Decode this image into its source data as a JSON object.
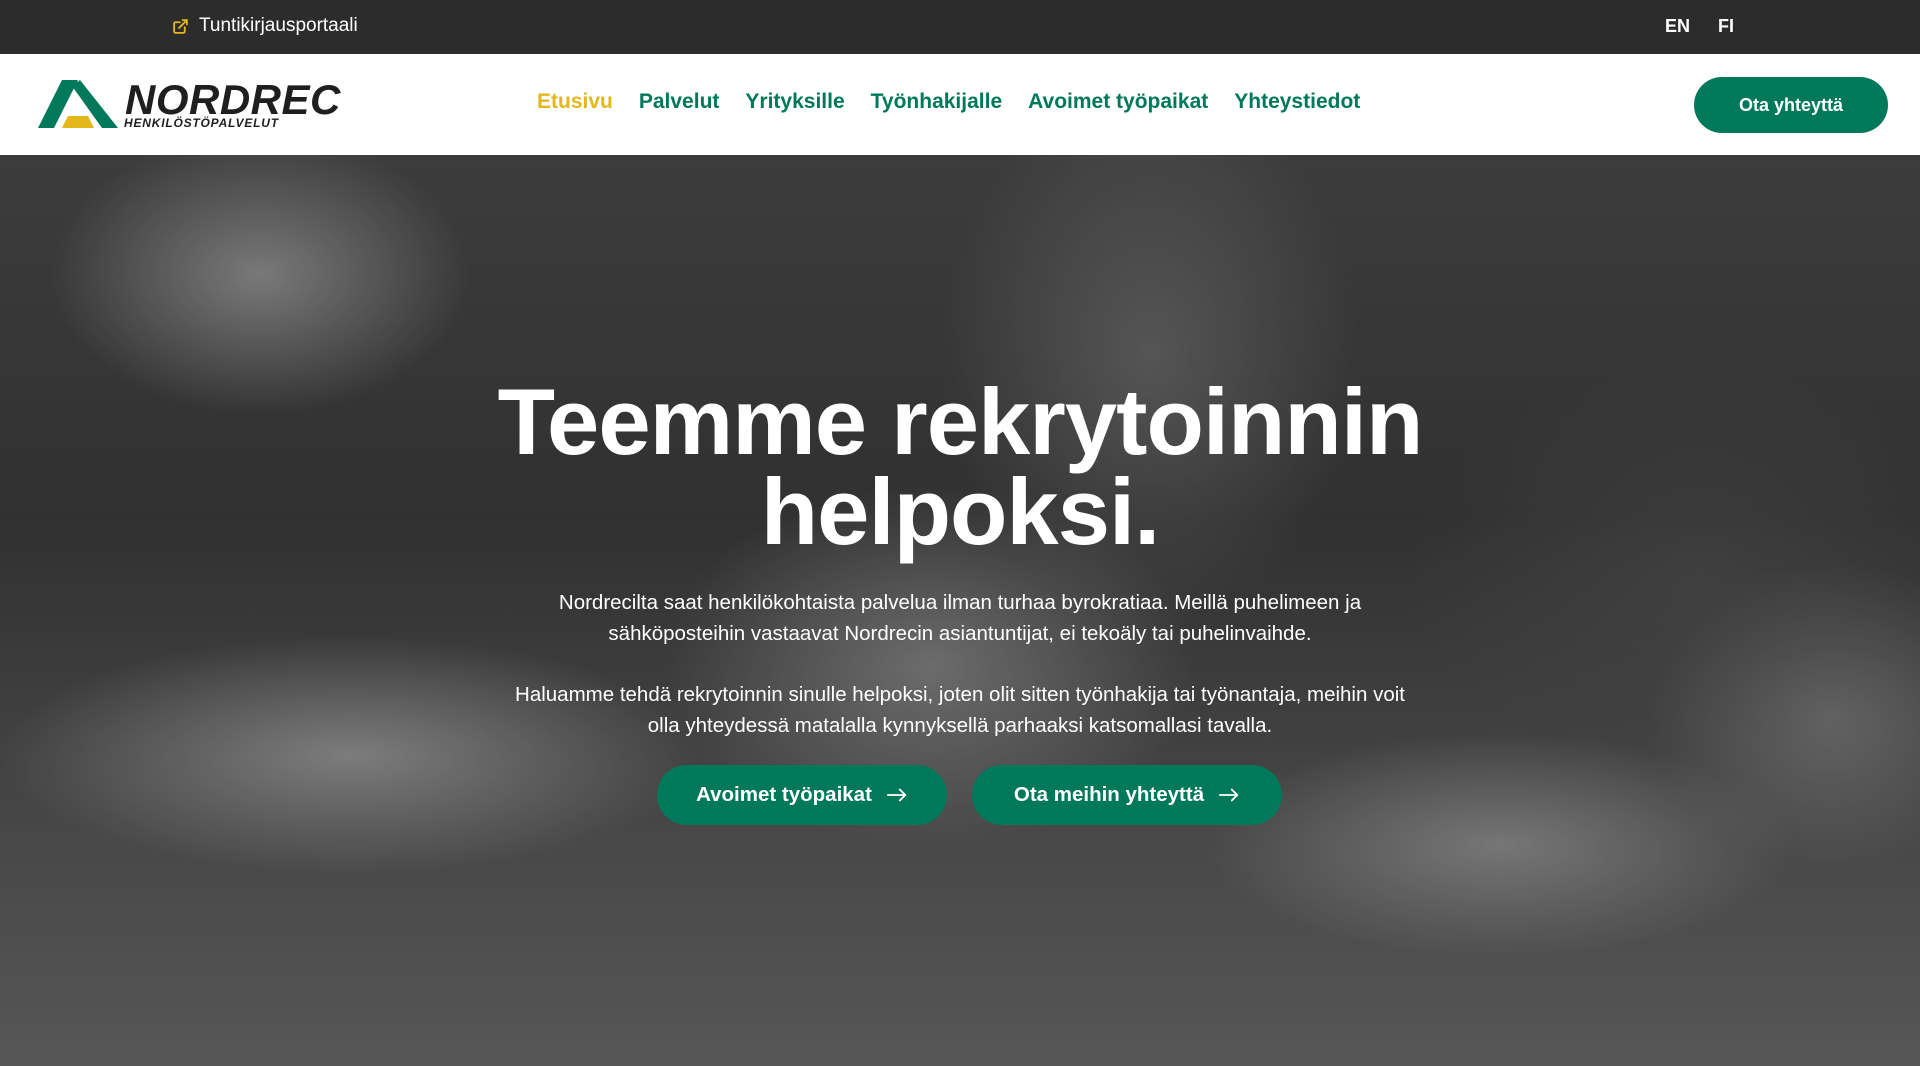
{
  "topbar": {
    "portal_label": "Tuntikirjausportaali",
    "portal_icon": "external-link-icon",
    "lang_en": "EN",
    "lang_fi": "FI"
  },
  "header": {
    "logo_name": "NORDREC",
    "logo_sub": "HENKILÖSTÖPALVELUT",
    "nav": [
      {
        "label": "Etusivu",
        "active": true
      },
      {
        "label": "Palvelut"
      },
      {
        "label": "Yrityksille"
      },
      {
        "label": "Työnhakijalle"
      },
      {
        "label": "Avoimet työpaikat"
      },
      {
        "label": "Yhteystiedot"
      }
    ],
    "cta": "Ota yhteyttä"
  },
  "hero": {
    "title_line1": "Teemme rekrytoinnin",
    "title_line2": "helpoksi.",
    "p1_line1": "Nordrecilta saat henkilökohtaista palvelua ilman turhaa byrokratiaa. Meillä puhelimeen ja",
    "p1_line2": "sähköposteihin vastaavat Nordrecin asiantuntijat, ei tekoäly tai puhelinvaihde.",
    "p2_line1": "Haluamme tehdä rekrytoinnin sinulle helpoksi, joten olit sitten työnhakija tai työnantaja, meihin voit",
    "p2_line2": "olla yhteydessä matalalla kynnyksellä parhaaksi katsomallasi tavalla.",
    "button1": "Avoimet työpaikat",
    "button2": "Ota meihin yhteyttä",
    "button_icon": "arrow-right-icon"
  },
  "colors": {
    "brand_green": "#00785a",
    "accent_yellow": "#e3b81b",
    "topbar_bg": "#2c2c2c"
  }
}
